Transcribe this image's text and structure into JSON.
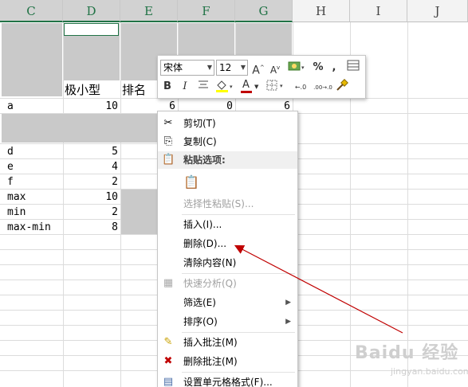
{
  "columns": [
    "C",
    "D",
    "E",
    "F",
    "G",
    "H",
    "I",
    "J"
  ],
  "cells": {
    "d_header": "极小型",
    "e_header": "排名",
    "row_a": {
      "label": "a",
      "d": "10",
      "e": "6",
      "f": "0",
      "g": "6"
    },
    "rows": [
      {
        "label": "d",
        "value": "5"
      },
      {
        "label": "e",
        "value": "4"
      },
      {
        "label": "f",
        "value": "2"
      },
      {
        "label": "max",
        "value": "10"
      },
      {
        "label": "min",
        "value": "2"
      },
      {
        "label": "max-min",
        "value": "8"
      }
    ]
  },
  "mini_toolbar": {
    "font_name": "宋体",
    "font_size": "12",
    "grow_font": "A",
    "shrink_font": "A",
    "percent": "%",
    "comma": ",",
    "bold": "B",
    "italic": "I",
    "font_color_letter": "A",
    "dec_increase": "←.0",
    "dec_decrease": ".00→.0"
  },
  "context_menu": {
    "cut": "剪切(T)",
    "copy": "复制(C)",
    "paste_options": "粘贴选项:",
    "paste_special": "选择性粘贴(S)...",
    "insert": "插入(I)...",
    "delete": "删除(D)...",
    "clear": "清除内容(N)",
    "quick_analysis": "快速分析(Q)",
    "filter": "筛选(E)",
    "sort": "排序(O)",
    "insert_comment": "插入批注(M)",
    "delete_comment": "删除批注(M)",
    "format_cells": "设置单元格格式(F)..."
  },
  "watermark": {
    "main": "Baidu 经验",
    "sub": "jingyan.baidu.com"
  },
  "colors": {
    "accent": "#217346",
    "selected_fill": "#c9c9c9",
    "arrow": "#c00000"
  }
}
